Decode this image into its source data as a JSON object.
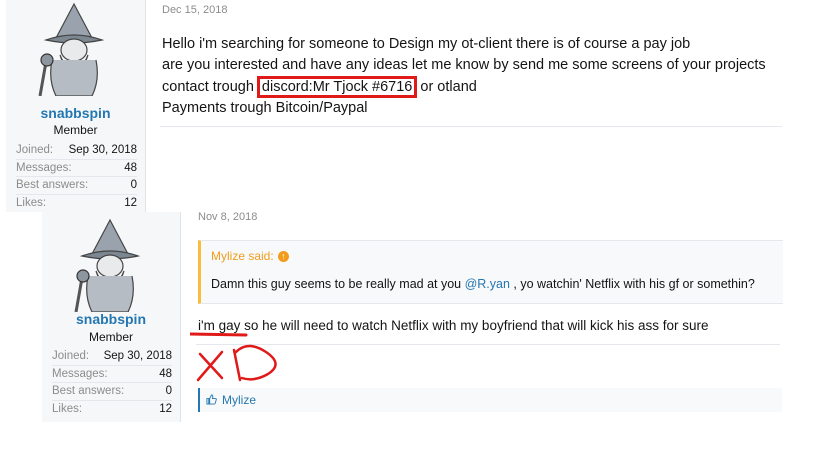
{
  "posts": [
    {
      "author": {
        "username": "snabbspin",
        "title": "Member",
        "stats": [
          {
            "label": "Joined:",
            "value": "Sep 30, 2018"
          },
          {
            "label": "Messages:",
            "value": "48"
          },
          {
            "label": "Best answers:",
            "value": "0"
          },
          {
            "label": "Likes:",
            "value": "12"
          }
        ]
      },
      "date": "Dec 15, 2018",
      "lines": [
        "Hello i'm searching for someone to Design my ot-client there is of course a pay job",
        "are you interested and have any ideas let me know by send me some screens of your projects"
      ],
      "contact_prefix": "contact trough ",
      "contact_highlight": "discord:Mr Tjock #6716",
      "contact_suffix": " or otland",
      "payment_line": "Payments trough Bitcoin/Paypal"
    },
    {
      "author": {
        "username": "snabbspin",
        "title": "Member",
        "stats": [
          {
            "label": "Joined:",
            "value": "Sep 30, 2018"
          },
          {
            "label": "Messages:",
            "value": "48"
          },
          {
            "label": "Best answers:",
            "value": "0"
          },
          {
            "label": "Likes:",
            "value": "12"
          }
        ]
      },
      "date": "Nov 8, 2018",
      "quote": {
        "author_line": "Mylize said:",
        "text_before": "Damn this guy seems to be really mad at you ",
        "mention": "@R.yan",
        "text_after": " , yo watchin' Netflix with his gf or somethin?"
      },
      "body": "i'm gay so he will need to watch Netflix with my boyfriend that will kick his ass for sure",
      "reactions": "Mylize"
    }
  ],
  "colors": {
    "username": "#2577b1",
    "quote_accent": "#f9bc3d",
    "highlight_red": "#e01919"
  },
  "icons": [
    "wizard-avatar",
    "quote-arrow-icon",
    "like-icon"
  ]
}
